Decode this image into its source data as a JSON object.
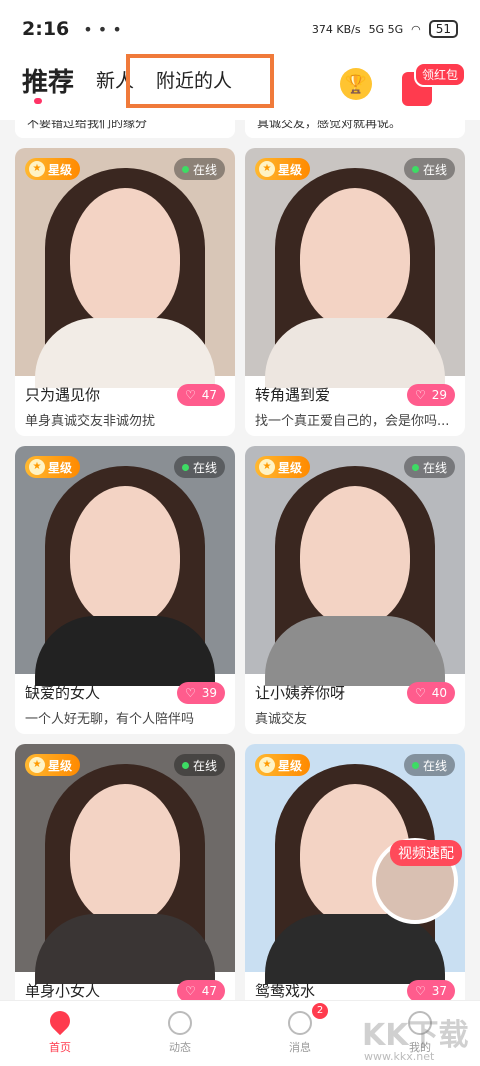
{
  "status": {
    "time": "2:16",
    "speed": "374 KB/s",
    "signal": "5G 5G",
    "battery": "51"
  },
  "tabs": [
    {
      "label": "推荐",
      "active": true
    },
    {
      "label": "新人",
      "active": false
    },
    {
      "label": "附近的人",
      "active": false
    }
  ],
  "header": {
    "redpacket_label": "领红包"
  },
  "prev_cards": [
    "不要错过给我们的缘分",
    "真诚交友，感觉对就再说。"
  ],
  "cards": [
    {
      "vip": "星级",
      "online": "在线",
      "name": "只为遇见你",
      "desc": "单身真诚交友非诚勿扰",
      "likes": "47",
      "bg": "#d8c6b7",
      "body": "#f2ece6"
    },
    {
      "vip": "星级",
      "online": "在线",
      "name": "转角遇到爱",
      "desc": "找一个真正爱自己的，会是你吗...",
      "likes": "29",
      "bg": "#c9c5c2",
      "body": "#ede6e0"
    },
    {
      "vip": "星级",
      "online": "在线",
      "name": "缺爱的女人",
      "desc": "一个人好无聊，有个人陪伴吗",
      "likes": "39",
      "bg": "#8a8f94",
      "body": "#222222"
    },
    {
      "vip": "星级",
      "online": "在线",
      "name": "让小姨养你呀",
      "desc": "真诚交友",
      "likes": "40",
      "bg": "#b7b9bd",
      "body": "#8d8d8d"
    },
    {
      "vip": "星级",
      "online": "在线",
      "name": "单身小女人",
      "desc": "",
      "likes": "47",
      "bg": "#6e6a68",
      "body": "#3a3534"
    },
    {
      "vip": "星级",
      "online": "在线",
      "name": "鸳鸯戏水",
      "desc": "",
      "likes": "37",
      "bg": "#c9dff2",
      "body": "#2b2b2b"
    }
  ],
  "video_match": "视频速配",
  "nav": [
    {
      "label": "首页",
      "active": true
    },
    {
      "label": "动态",
      "active": false
    },
    {
      "label": "消息",
      "active": false,
      "badge": "2"
    },
    {
      "label": "我的",
      "active": false
    }
  ],
  "watermark": {
    "logo": "KK下载",
    "url": "www.kkx.net"
  }
}
